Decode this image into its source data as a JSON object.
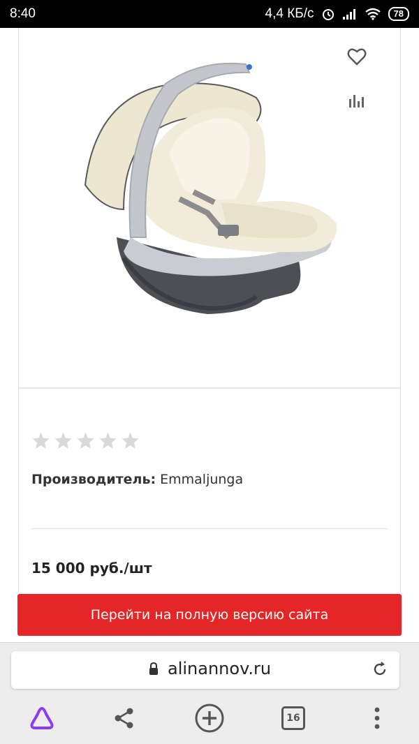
{
  "status_bar": {
    "time": "8:40",
    "network_speed": "4,4 КБ/с",
    "battery": "78"
  },
  "product": {
    "image_alt": "Автокресло Emmaljunga",
    "rating": 0,
    "rating_max": 5,
    "manufacturer_label": "Производитель:",
    "manufacturer_value": "Emmaljunga",
    "price": "15 000 руб./шт",
    "icons": [
      "heart-icon",
      "compare-icon"
    ]
  },
  "full_site_button": "Перейти на полную версию сайта",
  "browser": {
    "url": "alinannov.ru",
    "tabs_count": "16",
    "toolbar_icons": [
      "alice-icon",
      "share-icon",
      "new-tab-icon",
      "tabs-icon",
      "menu-icon"
    ]
  },
  "colors": {
    "accent_red": "#e42626",
    "alice_purple": "#8b3df5",
    "star_gray": "#d9d9d9"
  }
}
